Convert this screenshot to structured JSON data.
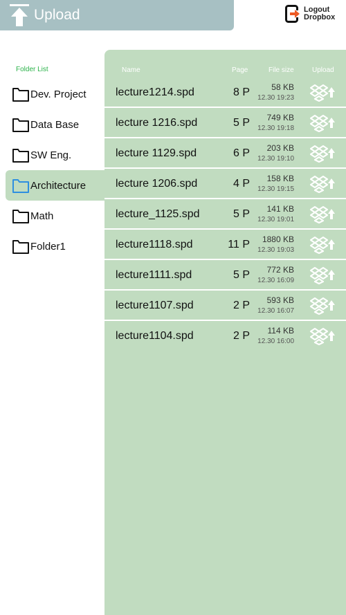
{
  "header": {
    "title": "Upload",
    "logout_line1": "Logout",
    "logout_line2": "Dropbox"
  },
  "sidebar": {
    "label": "Folder List",
    "items": [
      {
        "label": "Dev. Project",
        "active": false
      },
      {
        "label": "Data Base",
        "active": false
      },
      {
        "label": "SW Eng.",
        "active": false
      },
      {
        "label": "Architecture",
        "active": true
      },
      {
        "label": "Math",
        "active": false
      },
      {
        "label": "Folder1",
        "active": false
      }
    ]
  },
  "table": {
    "columns": {
      "name": "Name",
      "page": "Page",
      "size": "File size",
      "upload": "Upload"
    },
    "rows": [
      {
        "name": "lecture1214.spd",
        "pages": "8 P",
        "size": "58 KB",
        "date": "12.30 19:23"
      },
      {
        "name": "lecture 1216.spd",
        "pages": "5 P",
        "size": "749 KB",
        "date": "12.30 19:18"
      },
      {
        "name": "lecture 1129.spd",
        "pages": "6 P",
        "size": "203 KB",
        "date": "12.30 19:10"
      },
      {
        "name": "lecture 1206.spd",
        "pages": "4 P",
        "size": "158 KB",
        "date": "12.30 19:15"
      },
      {
        "name": "lecture_1125.spd",
        "pages": "5 P",
        "size": "141 KB",
        "date": "12.30 19:01"
      },
      {
        "name": "lecture1118.spd",
        "pages": "11 P",
        "size": "1880 KB",
        "date": "12.30 19:03"
      },
      {
        "name": "lecture1111.spd",
        "pages": "5 P",
        "size": "772 KB",
        "date": "12.30 16:09"
      },
      {
        "name": "lecture1107.spd",
        "pages": "2 P",
        "size": "593 KB",
        "date": "12.30 16:07"
      },
      {
        "name": "lecture1104.spd",
        "pages": "2 P",
        "size": "114 KB",
        "date": "12.30 16:00"
      }
    ]
  },
  "colors": {
    "header_bg": "#a7c0c3",
    "panel_bg": "#c1dcc0",
    "folder_label_green": "#2bb34a",
    "active_folder_blue": "#2e8fe0",
    "logout_arrow": "#ee5a24"
  },
  "icons": {
    "header": "upload-arrow-icon",
    "logout": "logout-icon",
    "folder": "folder-icon",
    "upload": "dropbox-upload-icon"
  }
}
